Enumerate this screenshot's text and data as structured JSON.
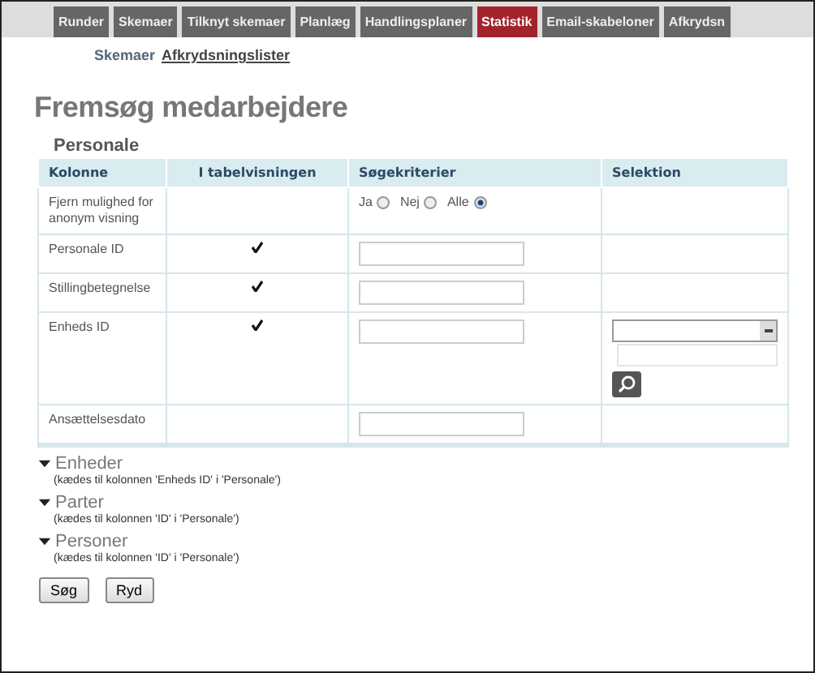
{
  "tabs": [
    {
      "label": "Runder",
      "selected": false
    },
    {
      "label": "Skemaer",
      "selected": false
    },
    {
      "label": "Tilknyt skemaer",
      "selected": false
    },
    {
      "label": "Planlæg",
      "selected": false
    },
    {
      "label": "Handlingsplaner",
      "selected": false
    },
    {
      "label": "Statistik",
      "selected": true
    },
    {
      "label": "Email-skabeloner",
      "selected": false
    },
    {
      "label": "Afkrydsn",
      "selected": false
    }
  ],
  "subnav": [
    {
      "label": "Skemaer",
      "selected": false
    },
    {
      "label": "Afkrydsningslister",
      "selected": true
    }
  ],
  "title": "Fremsøg medarbejdere",
  "section": "Personale",
  "table": {
    "columns": [
      "Kolonne",
      "I tabelvisningen",
      "Søgekriterier",
      "Selektion"
    ],
    "rows": [
      {
        "label": "Fjern mulighed for anonym visning",
        "in_table": false,
        "criteria": {
          "kind": "radios",
          "options": [
            {
              "label": "Ja",
              "selected": false
            },
            {
              "label": "Nej",
              "selected": false
            },
            {
              "label": "Alle",
              "selected": true
            }
          ]
        }
      },
      {
        "label": "Personale ID",
        "in_table": true,
        "criteria": {
          "kind": "text"
        }
      },
      {
        "label": "Stillingbetegnelse",
        "in_table": true,
        "criteria": {
          "kind": "text"
        }
      },
      {
        "label": "Enheds ID",
        "in_table": true,
        "criteria": {
          "kind": "text"
        },
        "selection": {
          "kind": "dropdown"
        }
      },
      {
        "label": "Ansættelsesdato",
        "in_table": false,
        "criteria": {
          "kind": "text"
        }
      }
    ]
  },
  "groups": [
    {
      "title": "Enheder",
      "note": "(kædes til kolonnen 'Enheds ID' i 'Personale')"
    },
    {
      "title": "Parter",
      "note": "(kædes til kolonnen 'ID' i 'Personale')"
    },
    {
      "title": "Personer",
      "note": "(kædes til kolonnen 'ID' i 'Personale')"
    }
  ],
  "buttons": [
    "Søg",
    "Ryd"
  ]
}
